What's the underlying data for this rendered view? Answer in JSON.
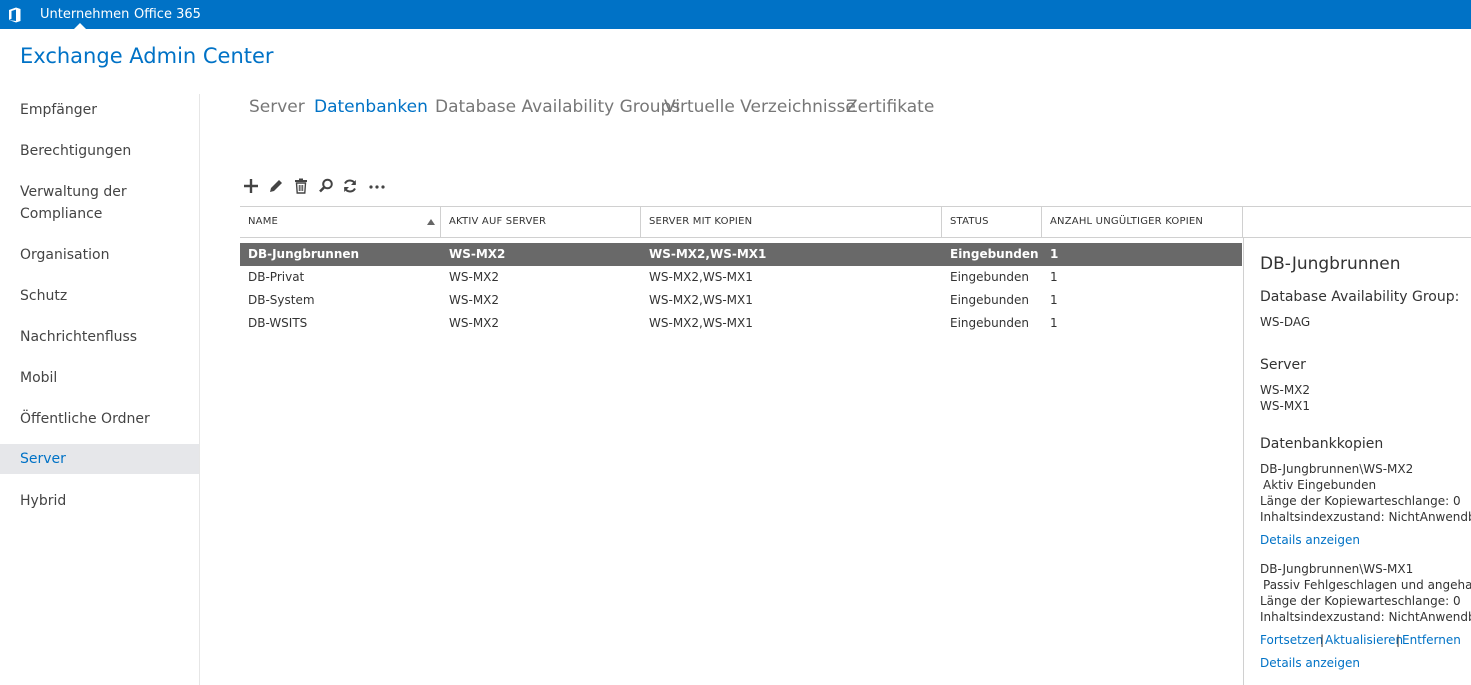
{
  "topbar": {
    "company": "Unternehmen",
    "office365": "Office 365"
  },
  "app_title": "Exchange Admin Center",
  "sidebar": {
    "items": [
      {
        "label": "Empfänger"
      },
      {
        "label": "Berechtigungen"
      },
      {
        "label": "Verwaltung der Compliance"
      },
      {
        "label": "Organisation"
      },
      {
        "label": "Schutz"
      },
      {
        "label": "Nachrichtenfluss"
      },
      {
        "label": "Mobil"
      },
      {
        "label": "Öffentliche Ordner"
      },
      {
        "label": "Server"
      },
      {
        "label": "Hybrid"
      }
    ],
    "active": "Server"
  },
  "tabs": [
    {
      "label": "Server"
    },
    {
      "label": "Datenbanken"
    },
    {
      "label": "Database Availability Groups"
    },
    {
      "label": "Virtuelle Verzeichnisse"
    },
    {
      "label": "Zertifikate"
    }
  ],
  "active_tab": "Datenbanken",
  "toolbar": {
    "icons": [
      "add-icon",
      "edit-icon",
      "delete-icon",
      "search-icon",
      "refresh-icon",
      "more-icon"
    ]
  },
  "table": {
    "columns": [
      "NAME",
      "AKTIV AUF SERVER",
      "SERVER MIT KOPIEN",
      "STATUS",
      "ANZAHL UNGÜLTIGER KOPIEN"
    ],
    "rows": [
      {
        "name": "DB-Jungbrunnen",
        "active_server": "WS-MX2",
        "servers": "WS-MX2,WS-MX1",
        "status": "Eingebunden",
        "bad_copies": "1",
        "selected": true
      },
      {
        "name": "DB-Privat",
        "active_server": "WS-MX2",
        "servers": "WS-MX2,WS-MX1",
        "status": "Eingebunden",
        "bad_copies": "1",
        "selected": false
      },
      {
        "name": "DB-System",
        "active_server": "WS-MX2",
        "servers": "WS-MX2,WS-MX1",
        "status": "Eingebunden",
        "bad_copies": "1",
        "selected": false
      },
      {
        "name": "DB-WSITS",
        "active_server": "WS-MX2",
        "servers": "WS-MX2,WS-MX1",
        "status": "Eingebunden",
        "bad_copies": "1",
        "selected": false
      }
    ]
  },
  "details": {
    "title": "DB-Jungbrunnen",
    "dag_label": "Database Availability Group:",
    "dag_value": "WS-DAG",
    "server_label": "Server",
    "servers": [
      "WS-MX2",
      "WS-MX1"
    ],
    "copies_label": "Datenbankkopien",
    "copies": [
      {
        "name": "DB-Jungbrunnen\\WS-MX2",
        "status": "Aktiv Eingebunden",
        "queue": "Länge der Kopiewarteschlange: 0",
        "index": "Inhaltsindexzustand: NichtAnwendbar",
        "details_link": "Details anzeigen"
      },
      {
        "name": "DB-Jungbrunnen\\WS-MX1",
        "status": "Passiv Fehlgeschlagen und angehalten",
        "queue": "Länge der Kopiewarteschlange: 0",
        "index": "Inhaltsindexzustand: NichtAnwendbar",
        "actions": {
          "resume": "Fortsetzen",
          "separator": "|",
          "update": "Aktualisieren",
          "remove": "Entfernen"
        },
        "details_link": "Details anzeigen"
      }
    ]
  },
  "colors": {
    "accent": "#0072c6",
    "selected_row": "#696969",
    "sidebar_active": "#e6e7ea"
  }
}
